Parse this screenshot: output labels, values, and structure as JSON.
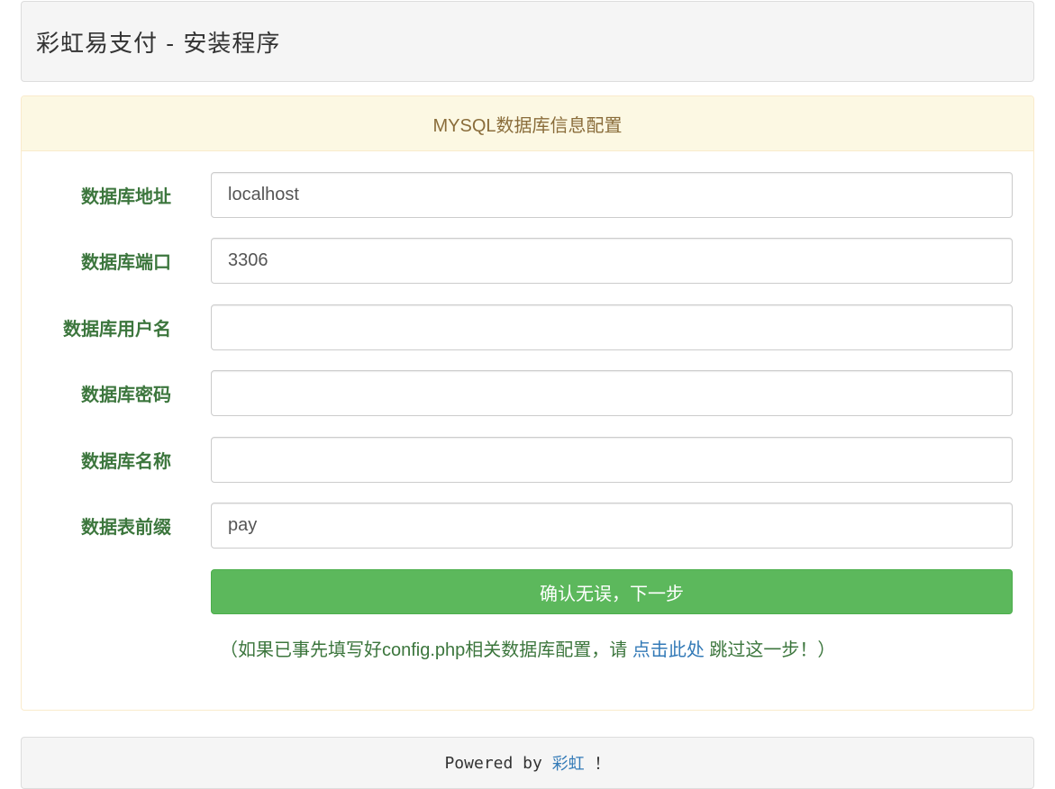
{
  "header": {
    "title": "彩虹易支付  -  安装程序"
  },
  "panel": {
    "heading": "MYSQL数据库信息配置"
  },
  "form": {
    "fields": [
      {
        "label": "数据库地址",
        "value": "localhost",
        "placeholder": ""
      },
      {
        "label": "数据库端口",
        "value": "3306",
        "placeholder": ""
      },
      {
        "label": "数据库用户名",
        "value": "",
        "placeholder": ""
      },
      {
        "label": "数据库密码",
        "value": "",
        "placeholder": ""
      },
      {
        "label": "数据库名称",
        "value": "",
        "placeholder": ""
      },
      {
        "label": "数据表前缀",
        "value": "pay",
        "placeholder": ""
      }
    ],
    "submit_label": "确认无误，下一步"
  },
  "hint": {
    "prefix": "（如果已事先填写好config.php相关数据库配置，请 ",
    "link_text": "点击此处",
    "suffix": " 跳过这一步！）"
  },
  "footer": {
    "prefix": "Powered by ",
    "link_text": "彩虹",
    "suffix": " ！"
  },
  "colors": {
    "label_green": "#3c763d",
    "heading_text": "#8a6d3b",
    "heading_bg": "#fcf8e3",
    "button_green": "#5cb85c",
    "link_blue": "#337ab7"
  }
}
